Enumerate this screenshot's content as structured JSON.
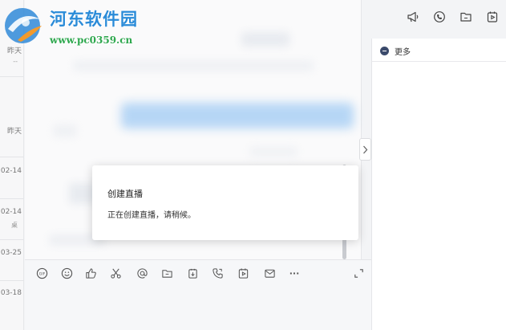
{
  "watermark": {
    "site_name": "河东软件园",
    "url": "www.pc0359.cn"
  },
  "conversation_list": {
    "items": [
      {
        "date": "昨天",
        "sub": "--"
      },
      {
        "date": "昨天",
        "sub": ""
      },
      {
        "date": "02-14",
        "sub": ""
      },
      {
        "date": "02-14",
        "sub": "桌"
      },
      {
        "date": "03-25",
        "sub": ""
      },
      {
        "date": "03-18",
        "sub": ""
      }
    ]
  },
  "right_panel": {
    "top_icons": [
      "megaphone-icon",
      "phone-icon",
      "folder-icon",
      "live-icon"
    ],
    "more_label": "更多"
  },
  "toolbar": {
    "icons": [
      "gif-icon",
      "emoji-icon",
      "thumbs-up-icon",
      "scissors-icon",
      "at-icon",
      "folder-icon",
      "task-icon",
      "call-icon",
      "live-icon",
      "mail-icon",
      "more-icon",
      "expand-icon"
    ],
    "more_glyph": "···"
  },
  "dialog": {
    "title": "创建直播",
    "message": "正在创建直播，请稍候。"
  },
  "colors": {
    "accent": "#2a8bd8",
    "watermark_green": "#2fa84f",
    "dialog_bg": "#ffffff"
  }
}
